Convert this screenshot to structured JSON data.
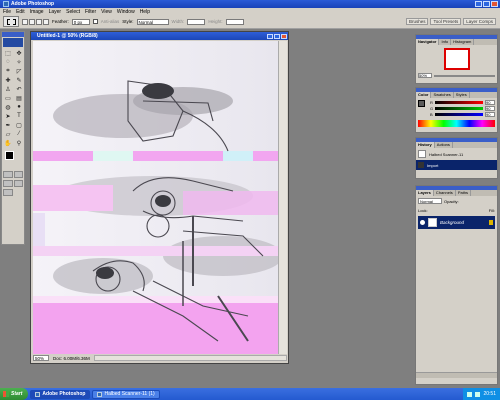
{
  "app": {
    "title": "Adobe Photoshop"
  },
  "menu": [
    "File",
    "Edit",
    "Image",
    "Layer",
    "Select",
    "Filter",
    "View",
    "Window",
    "Help"
  ],
  "options": {
    "feather_label": "Feather:",
    "feather_value": "0 px",
    "antialias_label": "Anti-alias",
    "style_label": "Style:",
    "style_value": "Normal",
    "width_label": "Width:",
    "height_label": "Height:",
    "palette_tabs": [
      "Brushes",
      "Tool Presets",
      "Layer Comps"
    ]
  },
  "document": {
    "title": "Untitled-1 @ 50% (RGB/8)",
    "zoom": "50%",
    "doc_size": "Doc: 6.00M/6.36M"
  },
  "navigator": {
    "tabs": [
      "Navigator",
      "Info",
      "Histogram"
    ],
    "zoom": "50%"
  },
  "color": {
    "tabs": [
      "Color",
      "Swatches",
      "Styles"
    ],
    "channels": [
      {
        "label": "R",
        "value": "90",
        "color": "#ff0000"
      },
      {
        "label": "G",
        "value": "90",
        "color": "#00a000"
      },
      {
        "label": "B",
        "value": "90",
        "color": "#0000ff"
      }
    ]
  },
  "history": {
    "tabs": [
      "History",
      "Actions"
    ],
    "snapshot": "Halbed Scanner-11",
    "items": [
      "Import"
    ]
  },
  "layers": {
    "tabs": [
      "Layers",
      "Channels",
      "Paths"
    ],
    "blend_mode": "Normal",
    "opacity_label": "Opacity:",
    "fill_label": "Fill:",
    "lock_label": "Lock:",
    "layer_name": "Background"
  },
  "taskbar": {
    "start": "Start",
    "tasks": [
      "Adobe Photoshop",
      "Halbed Scanner-11 (1)"
    ],
    "clock": "20:51"
  }
}
